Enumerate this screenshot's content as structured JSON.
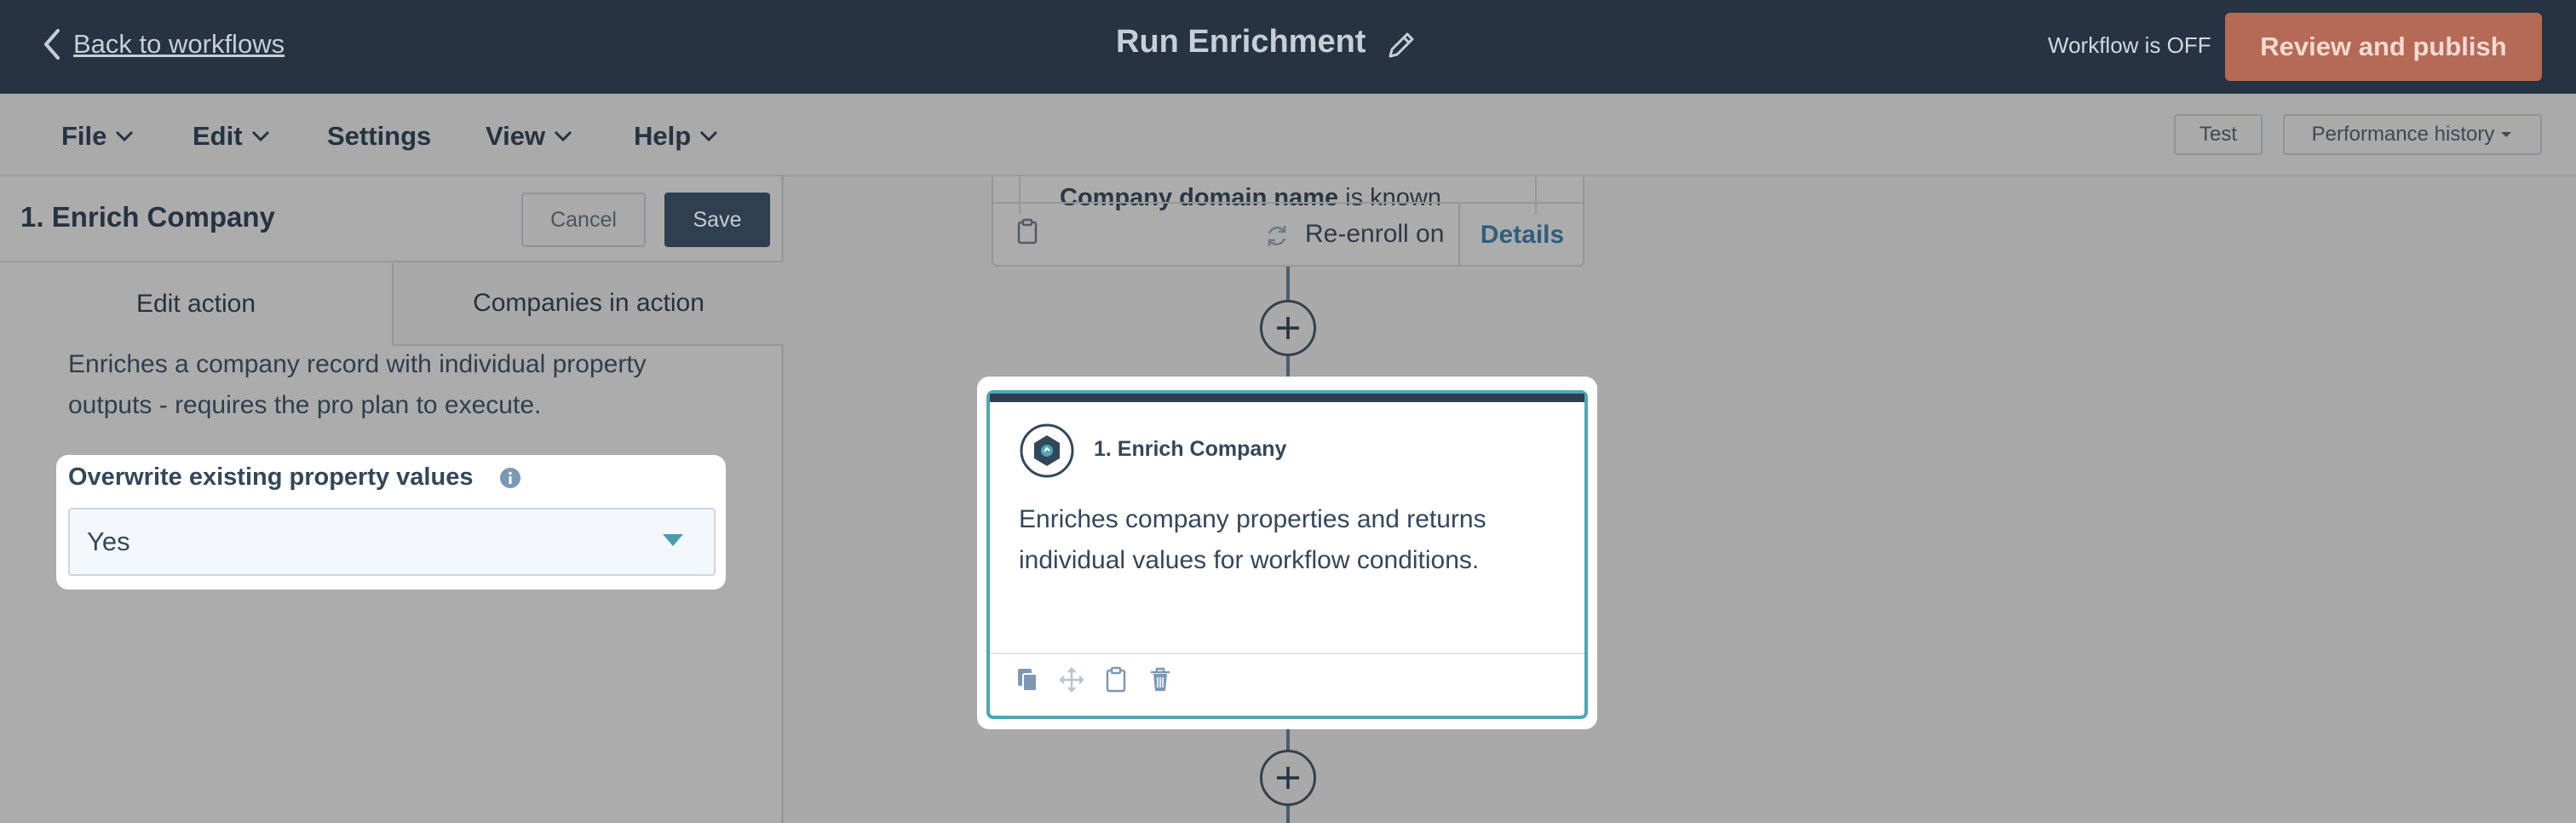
{
  "header": {
    "back_label": "Back to workflows",
    "workflow_title": "Run Enrichment",
    "status_text": "Workflow is OFF",
    "publish_label": "Review and publish"
  },
  "menu": {
    "file": "File",
    "edit": "Edit",
    "settings": "Settings",
    "view": "View",
    "help": "Help",
    "test": "Test",
    "performance": "Performance history"
  },
  "panel": {
    "title": "1. Enrich Company",
    "cancel_label": "Cancel",
    "save_label": "Save",
    "tab_edit": "Edit action",
    "tab_companies": "Companies in action",
    "description": "Enriches a company record with individual property outputs - requires the pro plan to execute.",
    "overwrite_label": "Overwrite existing property values",
    "overwrite_value": "Yes"
  },
  "canvas": {
    "prev_card": {
      "property": "Company domain name",
      "condition": " is known"
    },
    "reenroll_label": "Re-enroll on",
    "details_label": "Details",
    "action_card": {
      "title": "1. Enrich Company",
      "description": "Enriches company properties and returns individual values for workflow conditions."
    }
  },
  "colors": {
    "topbar": "#253342",
    "publish": "#b56a55",
    "accent_border": "#4ea6b5",
    "link": "#2e5f7e"
  },
  "icons": [
    "chevron-left-icon",
    "pencil-icon",
    "chevron-down-icon",
    "info-icon",
    "clipboard-icon",
    "refresh-icon",
    "plus-icon",
    "enrich-icon",
    "copy-icon",
    "move-icon",
    "trash-icon"
  ]
}
